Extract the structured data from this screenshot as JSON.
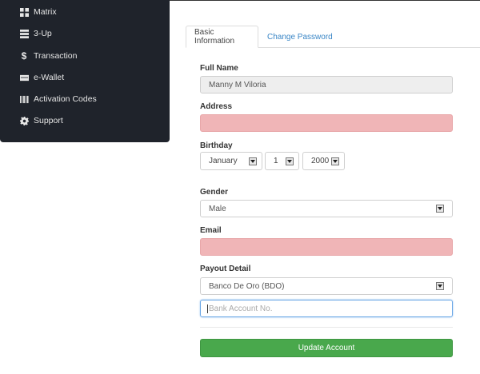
{
  "sidebar": {
    "items": [
      {
        "label": "Matrix",
        "icon": "grid-icon"
      },
      {
        "label": "3-Up",
        "icon": "server-icon"
      },
      {
        "label": "Transaction",
        "icon": "dollar-icon"
      },
      {
        "label": "e-Wallet",
        "icon": "credit-card-icon"
      },
      {
        "label": "Activation Codes",
        "icon": "barcode-icon"
      },
      {
        "label": "Support",
        "icon": "gear-icon"
      }
    ]
  },
  "tabs": [
    {
      "label": "Basic Information",
      "active": true
    },
    {
      "label": "Change Password",
      "active": false
    }
  ],
  "form": {
    "full_name_label": "Full Name",
    "full_name_value": "Manny M Viloria",
    "address_label": "Address",
    "address_value": "",
    "birthday_label": "Birthday",
    "birthday_month": "January",
    "birthday_day": "1",
    "birthday_year": "2000",
    "gender_label": "Gender",
    "gender_value": "Male",
    "email_label": "Email",
    "email_value": "",
    "payout_label": "Payout Detail",
    "payout_value": "Banco De Oro (BDO)",
    "bank_account_placeholder": "Bank Account No.",
    "submit_label": "Update Account"
  },
  "colors": {
    "sidebar_bg": "#1f232b",
    "error_bg": "#f0b5b7",
    "button_green": "#49a84c",
    "link_blue": "#3a86c6"
  }
}
